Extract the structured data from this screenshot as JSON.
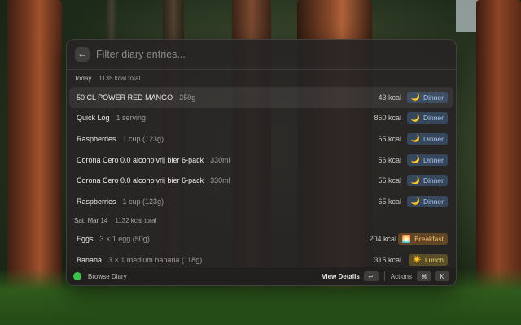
{
  "search": {
    "placeholder": "Filter diary entries..."
  },
  "sections": [
    {
      "title": "Today",
      "total": "1135 kcal total",
      "items": [
        {
          "name": "50 CL POWER RED MANGO",
          "qty": "250g",
          "kcal": "43 kcal",
          "meal": "Dinner",
          "meal_icon": "moon-icon",
          "selected": true
        },
        {
          "name": "Quick Log",
          "qty": "1 serving",
          "kcal": "850 kcal",
          "meal": "Dinner",
          "meal_icon": "moon-icon"
        },
        {
          "name": "Raspberries",
          "qty": "1 cup (123g)",
          "kcal": "65 kcal",
          "meal": "Dinner",
          "meal_icon": "moon-icon"
        },
        {
          "name": "Corona Cero 0.0 alcoholvrij bier 6-pack",
          "qty": "330ml",
          "kcal": "56 kcal",
          "meal": "Dinner",
          "meal_icon": "moon-icon"
        },
        {
          "name": "Corona Cero 0.0 alcoholvrij bier 6-pack",
          "qty": "330ml",
          "kcal": "56 kcal",
          "meal": "Dinner",
          "meal_icon": "moon-icon"
        },
        {
          "name": "Raspberries",
          "qty": "1 cup (123g)",
          "kcal": "65 kcal",
          "meal": "Dinner",
          "meal_icon": "moon-icon"
        }
      ]
    },
    {
      "title": "Sat, Mar 14",
      "total": "1132 kcal total",
      "items": [
        {
          "name": "Eggs",
          "qty": "3 × 1 egg (50g)",
          "kcal": "204 kcal",
          "meal": "Breakfast",
          "meal_icon": "sunrise-icon"
        },
        {
          "name": "Banana",
          "qty": "3 × 1 medium banana (118g)",
          "kcal": "315 kcal",
          "meal": "Lunch",
          "meal_icon": "sun-icon"
        }
      ]
    }
  ],
  "footer": {
    "command": "Browse Diary",
    "primary_action": "View Details",
    "primary_key": "↵",
    "actions_label": "Actions",
    "actions_key_1": "⌘",
    "actions_key_2": "K"
  },
  "colors": {
    "dinner": "#a9c8ee",
    "breakfast": "#f0c070",
    "lunch": "#e8d47a",
    "status": "#3ec24a"
  }
}
